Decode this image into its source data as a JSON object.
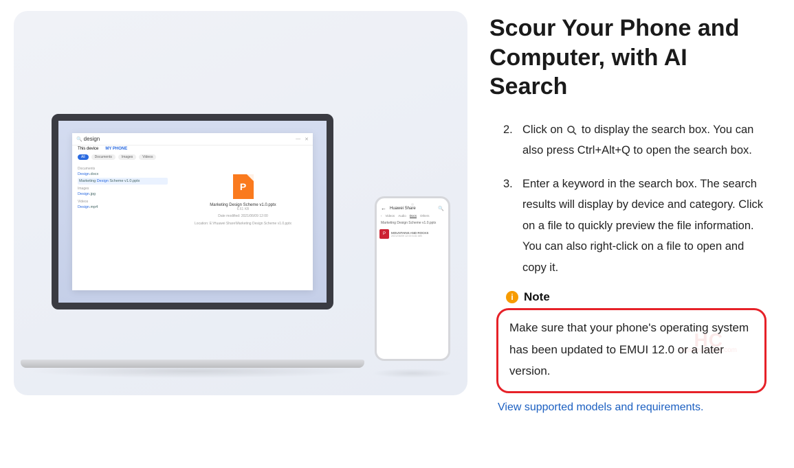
{
  "heading": "Scour Your Phone and Computer, with AI Search",
  "steps": {
    "s2_num": "2.",
    "s2_a": "Click on",
    "s2_b": "to display the search box. You can also press Ctrl+Alt+Q to open the search box.",
    "s3_num": "3.",
    "s3": "Enter a keyword in the search box. The search results will display by device and category. Click on a file to quickly preview the file information. You can also right-click on a file to open and copy it."
  },
  "note": {
    "label": "Note",
    "text": "Make sure that your phone's operating system has been updated to EMUI 12.0 or a later version."
  },
  "link": "View supported models and requirements.",
  "watermark": {
    "big": "HC",
    "small": "huaweicentral.com"
  },
  "laptop": {
    "search": "design",
    "tab_this": "This device",
    "tab_phone": "MY PHONE",
    "filters": {
      "all": "All",
      "docs": "Documents",
      "images": "Images",
      "videos": "Videos"
    },
    "secs": {
      "doc_label": "Documents",
      "doc1_pre": "Design",
      "doc1_suf": ".docx",
      "doc2_a": "Marketing ",
      "doc2_kw": "Design",
      "doc2_b": " Scheme v1.0.pptx",
      "img_label": "Images",
      "img1_pre": "Design",
      "img1_suf": ".jpg",
      "vid_label": "Videos",
      "vid1_pre": "Design",
      "vid1_suf": ".mp4"
    },
    "preview": {
      "icon": "P",
      "name": "Marketing Design Scheme v1.0.pptx",
      "size": "6.61 KB",
      "date": "Date modified: 2021/06/09 12:00",
      "loc": "Location: E:\\Huawei Share\\Marketing Design Scheme v1.0.pptx"
    }
  },
  "phone": {
    "title": "Huawei Share",
    "tabs": {
      "t1": "Videos",
      "t2": "Audio",
      "t3": "Docs",
      "t4": "Others"
    },
    "row1": "Marketing Design Scheme v1.0.pptx",
    "chip": {
      "name": "MOUNTAINS AND ROCKS",
      "sub": "2021/06/09 12:00 6.61 MB",
      "ico": "P"
    }
  }
}
